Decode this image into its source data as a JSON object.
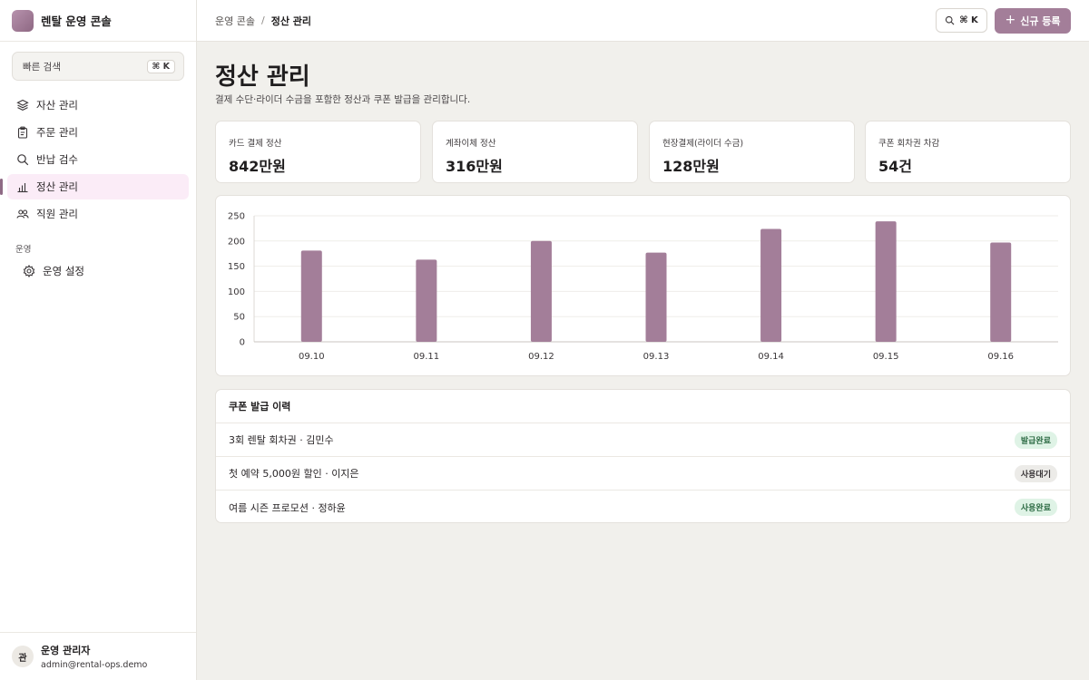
{
  "brand": {
    "name": "렌탈 운영 콘솔"
  },
  "sidebar": {
    "quick_search": {
      "label": "빠른 검색",
      "shortcut": "⌘ K"
    },
    "items": [
      {
        "label": "자산 관리",
        "icon": "layers-icon",
        "active": false
      },
      {
        "label": "주문 관리",
        "icon": "clipboard-icon",
        "active": false
      },
      {
        "label": "반납 검수",
        "icon": "search-icon",
        "active": false
      },
      {
        "label": "정산 관리",
        "icon": "bar-chart-icon",
        "active": true
      },
      {
        "label": "직원 관리",
        "icon": "users-icon",
        "active": false
      }
    ],
    "section_label": "운영",
    "settings": {
      "label": "운영 설정",
      "icon": "gear-icon"
    }
  },
  "user": {
    "initial": "관",
    "name": "운영 관리자",
    "email": "admin@rental-ops.demo"
  },
  "topbar": {
    "breadcrumb": [
      "운영 콘솔",
      "정산 관리"
    ],
    "separator": "/",
    "cmdk_label": "⌘ K",
    "new_button": {
      "icon": "+",
      "label": "신규 등록"
    }
  },
  "page": {
    "title": "정산 관리",
    "description": "결제 수단·라이더 수금을 포함한 정산과 쿠폰 발급을 관리합니다."
  },
  "stats": [
    {
      "label": "카드 결제 정산",
      "value": "842만원"
    },
    {
      "label": "계좌이체 정산",
      "value": "316만원"
    },
    {
      "label": "현장결제(라이더 수금)",
      "value": "128만원"
    },
    {
      "label": "쿠폰 회차권 차감",
      "value": "54건"
    }
  ],
  "chart_data": {
    "type": "bar",
    "categories": [
      "09.10",
      "09.11",
      "09.12",
      "09.13",
      "09.14",
      "09.15",
      "09.16"
    ],
    "values": [
      181,
      163,
      200,
      177,
      224,
      239,
      197
    ],
    "ylim": [
      0,
      250
    ],
    "yticks": [
      0,
      50,
      100,
      150,
      200,
      250
    ],
    "color": "#a37e99",
    "grid": true
  },
  "coupons": {
    "title": "쿠폰 발급 이력",
    "rows": [
      {
        "text": "3회 렌탈 회차권 · 김민수",
        "status": "발급완료",
        "tone": "green"
      },
      {
        "text": "첫 예약 5,000원 할인 · 이지은",
        "status": "사용대기",
        "tone": "gray"
      },
      {
        "text": "여름 시즌 프로모션 · 정하윤",
        "status": "사용완료",
        "tone": "green"
      }
    ]
  },
  "colors": {
    "accent": "#a37e99",
    "active_bg": "#fbecf7",
    "page_bg": "#f1f0ec"
  }
}
